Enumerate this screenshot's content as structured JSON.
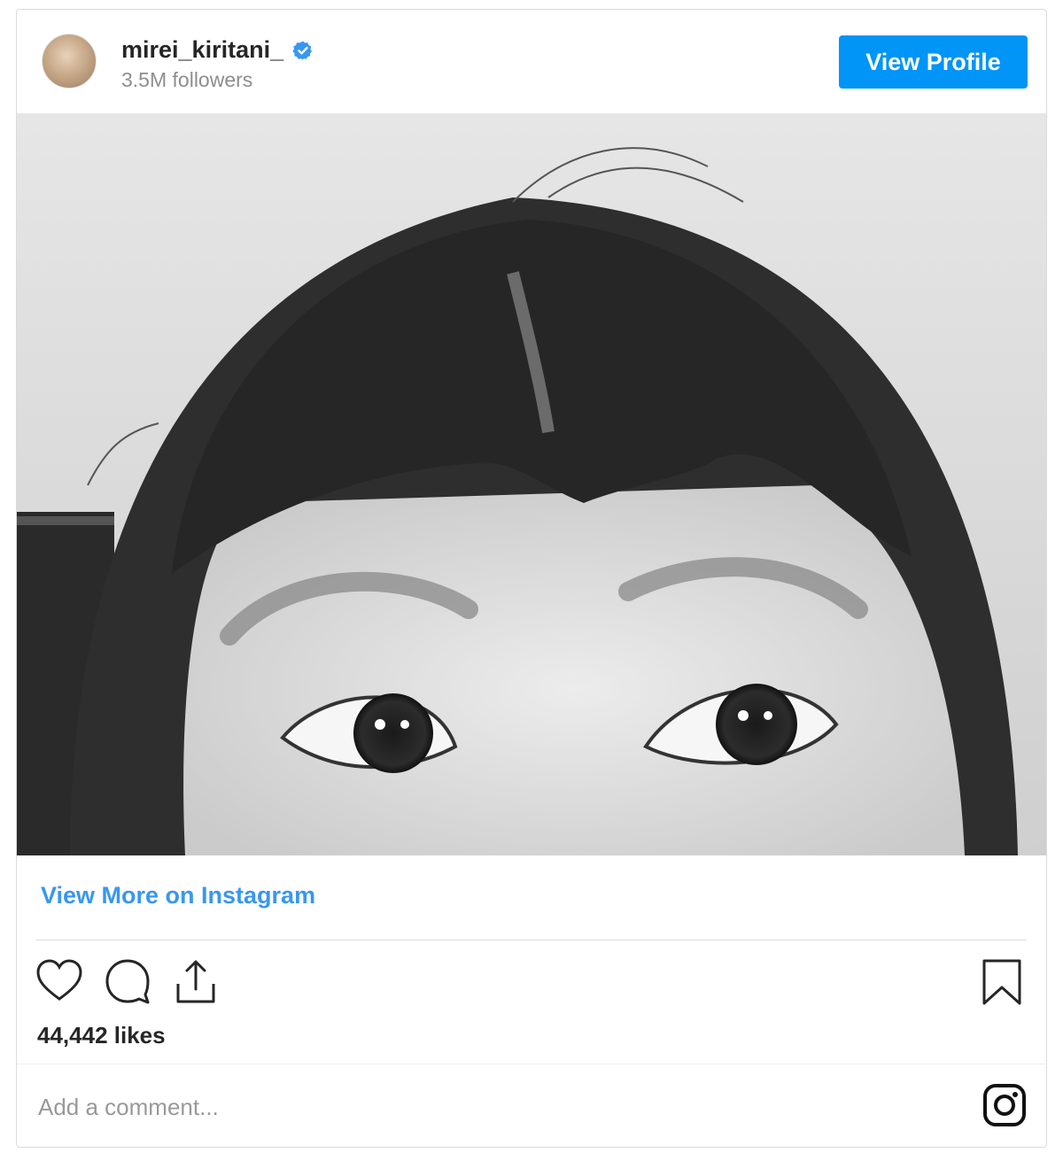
{
  "header": {
    "username": "mirei_kiritani_",
    "followers": "3.5M followers",
    "view_profile_label": "View Profile",
    "verified_icon": "verified-badge-icon"
  },
  "post": {
    "image_description": "",
    "view_more_label": "View More on Instagram",
    "likes": "44,442 likes"
  },
  "actions": {
    "icons": [
      "heart-icon",
      "comment-icon",
      "share-icon",
      "bookmark-icon"
    ]
  },
  "comment": {
    "placeholder": "Add a comment..."
  },
  "colors": {
    "accent": "#0095f6",
    "link": "#3897f0",
    "text": "#262626",
    "muted": "#8e8e8e"
  }
}
